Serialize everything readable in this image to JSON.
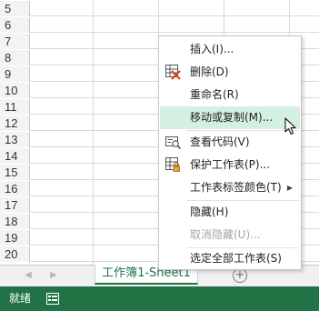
{
  "rows": [
    "5",
    "6",
    "7",
    "8",
    "9",
    "10",
    "11",
    "12",
    "13",
    "14",
    "15",
    "16",
    "17",
    "18",
    "19",
    "20"
  ],
  "context_menu": {
    "items": [
      {
        "label": "插入(I)...",
        "state": "normal"
      },
      {
        "label": "删除(D)",
        "state": "normal",
        "icon": "delete-sheet-icon"
      },
      {
        "label": "重命名(R)",
        "state": "normal"
      },
      {
        "label": "移动或复制(M)...",
        "state": "hover"
      },
      {
        "label": "查看代码(V)",
        "state": "normal",
        "icon": "view-code-icon"
      },
      {
        "label": "保护工作表(P)...",
        "state": "normal",
        "icon": "protect-sheet-icon"
      },
      {
        "label": "工作表标签颜色(T)",
        "state": "normal",
        "submenu": true
      },
      {
        "label": "隐藏(H)",
        "state": "normal"
      },
      {
        "label": "取消隐藏(U)...",
        "state": "disabled"
      },
      {
        "label": "选定全部工作表(S)",
        "state": "normal"
      }
    ]
  },
  "tabs": {
    "active_sheet": "工作簿1-Sheet1",
    "add_symbol": "+"
  },
  "status": {
    "ready": "就绪"
  },
  "colors": {
    "accent": "#217346",
    "hover": "#d3f0e0"
  }
}
